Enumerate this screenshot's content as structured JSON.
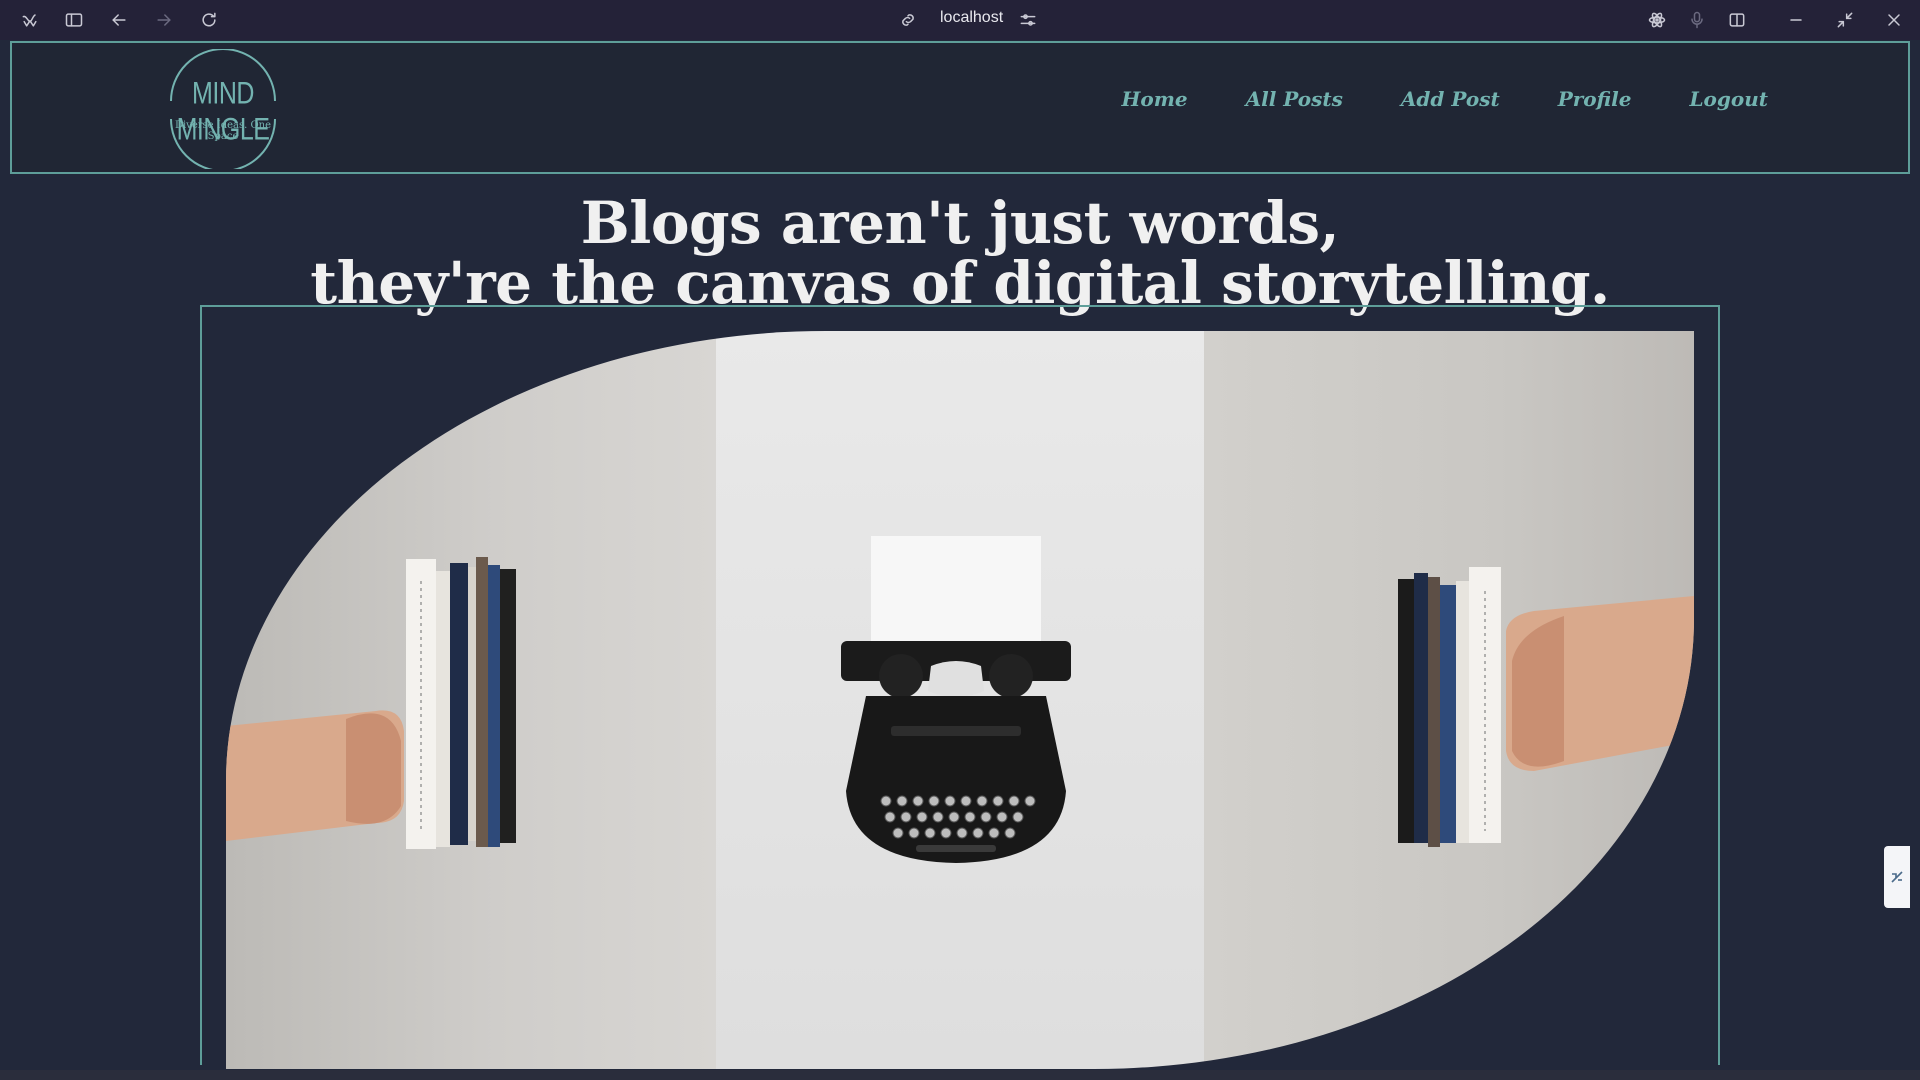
{
  "browser": {
    "url": "localhost"
  },
  "site": {
    "logo_title": "MIND MINGLE",
    "logo_tagline": "Diverse Ideas. One Space",
    "nav": [
      "Home",
      "All Posts",
      "Add Post",
      "Profile",
      "Logout"
    ]
  },
  "hero": {
    "line1": "Blogs aren't just words,",
    "line2": "they're the canvas of digital storytelling."
  },
  "colors": {
    "accent": "#73b3b0",
    "background": "#22283a",
    "chrome": "#242238"
  }
}
